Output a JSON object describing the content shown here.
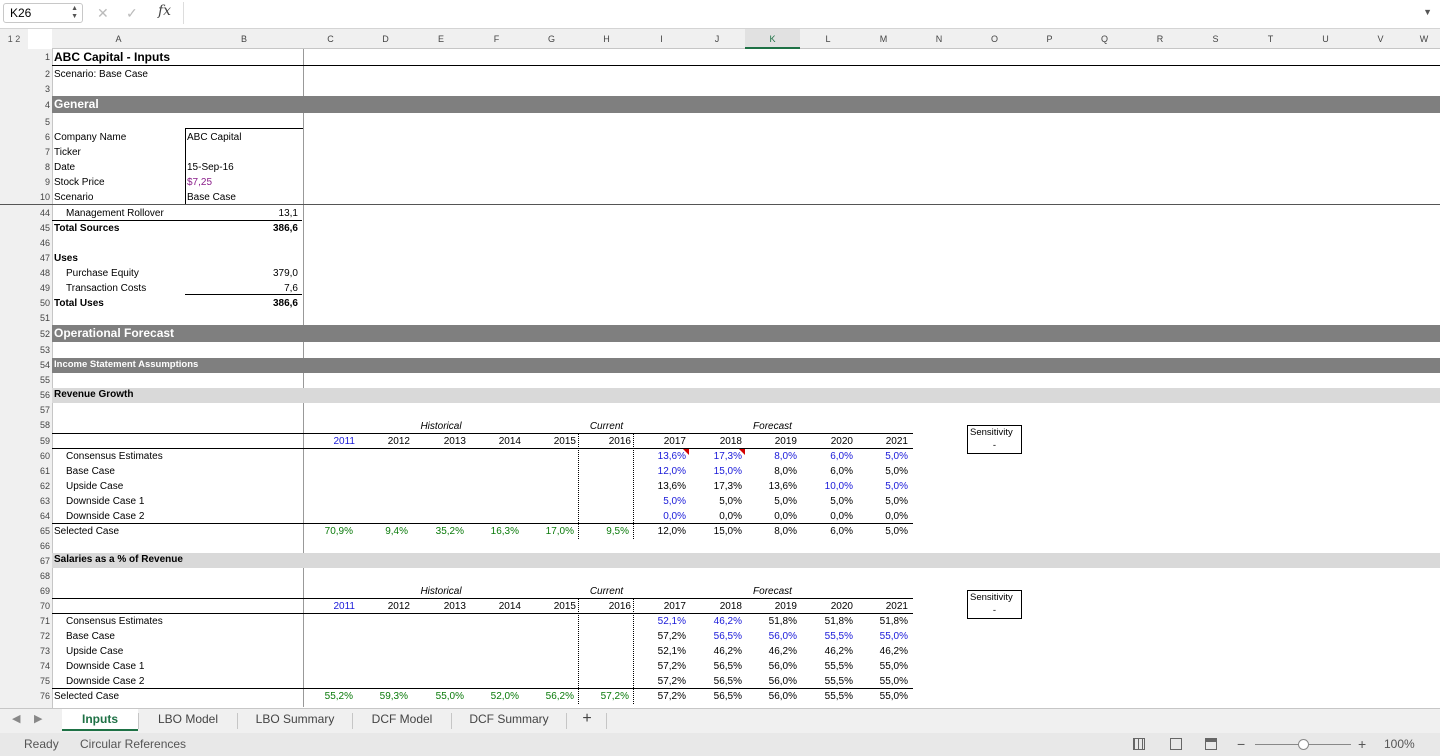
{
  "formula_bar": {
    "name_box": "K26",
    "cancel_icon": "✕",
    "enter_icon": "✓",
    "fx": "fx",
    "formula": ""
  },
  "outline_levels": "1 2",
  "columns": [
    "A",
    "B",
    "C",
    "D",
    "E",
    "F",
    "G",
    "H",
    "I",
    "J",
    "K",
    "L",
    "M",
    "N",
    "O",
    "P",
    "Q",
    "R",
    "S",
    "T",
    "U",
    "V",
    "W"
  ],
  "selected_column": "K",
  "rows": [
    1,
    2,
    3,
    4,
    5,
    6,
    7,
    8,
    9,
    10,
    44,
    45,
    46,
    47,
    48,
    49,
    50,
    51,
    52,
    53,
    54,
    55,
    56,
    57,
    58,
    59,
    60,
    61,
    62,
    63,
    64,
    65,
    66,
    67,
    68,
    69,
    70,
    71,
    72,
    73,
    74,
    75,
    76
  ],
  "header": {
    "title": "ABC Capital - Inputs",
    "scenario": "Scenario: Base Case"
  },
  "general": {
    "section": "General",
    "labels": [
      "Company Name",
      "Ticker",
      "Date",
      "Stock Price",
      "Scenario"
    ],
    "values": [
      "ABC Capital",
      "",
      "15-Sep-16",
      "$7,25",
      "Base Case"
    ]
  },
  "sources_uses": {
    "mgmt_label": "Management Rollover",
    "mgmt_value": "13,1",
    "total_sources_label": "Total Sources",
    "total_sources_value": "386,6",
    "uses_label": "Uses",
    "purchase_label": "Purchase Equity",
    "purchase_value": "379,0",
    "txn_label": "Transaction Costs",
    "txn_value": "7,6",
    "total_uses_label": "Total Uses",
    "total_uses_value": "386,6"
  },
  "operational": {
    "section": "Operational Forecast",
    "subsection": "Income Statement Assumptions"
  },
  "revenue": {
    "title": "Revenue Growth",
    "historical": "Historical",
    "current": "Current",
    "forecast": "Forecast",
    "years": [
      "2011",
      "2012",
      "2013",
      "2014",
      "2015",
      "2016",
      "2017",
      "2018",
      "2019",
      "2020",
      "2021"
    ],
    "sensitivity_label": "Sensitivity",
    "sensitivity_value": "-",
    "cases": [
      {
        "label": "Consensus Estimates",
        "values": [
          "13,6%",
          "17,3%",
          "8,0%",
          "6,0%",
          "5,0%"
        ],
        "colors": [
          "blue",
          "blue",
          "blue",
          "blue",
          "blue"
        ]
      },
      {
        "label": "Base Case",
        "values": [
          "12,0%",
          "15,0%",
          "8,0%",
          "6,0%",
          "5,0%"
        ],
        "colors": [
          "blue",
          "blue",
          "",
          "",
          ""
        ]
      },
      {
        "label": "Upside Case",
        "values": [
          "13,6%",
          "17,3%",
          "13,6%",
          "10,0%",
          "5,0%"
        ],
        "colors": [
          "",
          "",
          "",
          "blue",
          "blue"
        ]
      },
      {
        "label": "Downside Case 1",
        "values": [
          "5,0%",
          "5,0%",
          "5,0%",
          "5,0%",
          "5,0%"
        ],
        "colors": [
          "blue",
          "",
          "",
          "",
          ""
        ]
      },
      {
        "label": "Downside Case 2",
        "values": [
          "0,0%",
          "0,0%",
          "0,0%",
          "0,0%",
          "0,0%"
        ],
        "colors": [
          "blue",
          "",
          "",
          "",
          ""
        ]
      }
    ],
    "selected_label": "Selected Case",
    "selected_hist": [
      "70,9%",
      "9,4%",
      "35,2%",
      "16,3%",
      "17,0%",
      "9,5%"
    ],
    "selected_fcst": [
      "12,0%",
      "15,0%",
      "8,0%",
      "6,0%",
      "5,0%"
    ]
  },
  "salaries": {
    "title": "Salaries as a % of Revenue",
    "historical": "Historical",
    "current": "Current",
    "forecast": "Forecast",
    "years": [
      "2011",
      "2012",
      "2013",
      "2014",
      "2015",
      "2016",
      "2017",
      "2018",
      "2019",
      "2020",
      "2021"
    ],
    "sensitivity_label": "Sensitivity",
    "sensitivity_value": "-",
    "cases": [
      {
        "label": "Consensus Estimates",
        "values": [
          "52,1%",
          "46,2%",
          "51,8%",
          "51,8%",
          "51,8%"
        ],
        "colors": [
          "blue",
          "blue",
          "",
          "",
          ""
        ]
      },
      {
        "label": "Base Case",
        "values": [
          "57,2%",
          "56,5%",
          "56,0%",
          "55,5%",
          "55,0%"
        ],
        "colors": [
          "",
          "blue",
          "blue",
          "blue",
          "blue"
        ]
      },
      {
        "label": "Upside Case",
        "values": [
          "52,1%",
          "46,2%",
          "46,2%",
          "46,2%",
          "46,2%"
        ],
        "colors": [
          "",
          "",
          "",
          "",
          ""
        ]
      },
      {
        "label": "Downside Case 1",
        "values": [
          "57,2%",
          "56,5%",
          "56,0%",
          "55,5%",
          "55,0%"
        ],
        "colors": [
          "",
          "",
          "",
          "",
          ""
        ]
      },
      {
        "label": "Downside Case 2",
        "values": [
          "57,2%",
          "56,5%",
          "56,0%",
          "55,5%",
          "55,0%"
        ],
        "colors": [
          "",
          "",
          "",
          "",
          ""
        ]
      }
    ],
    "selected_label": "Selected Case",
    "selected_hist": [
      "55,2%",
      "59,3%",
      "55,0%",
      "52,0%",
      "56,2%",
      "57,2%"
    ],
    "selected_fcst": [
      "57,2%",
      "56,5%",
      "56,0%",
      "55,5%",
      "55,0%"
    ]
  },
  "tabs": [
    "Inputs",
    "LBO Model",
    "LBO Summary",
    "DCF Model",
    "DCF Summary"
  ],
  "add_sheet": "+",
  "status": {
    "ready": "Ready",
    "circular": "Circular References",
    "zoom": "100%",
    "minus": "−",
    "plus": "+"
  }
}
